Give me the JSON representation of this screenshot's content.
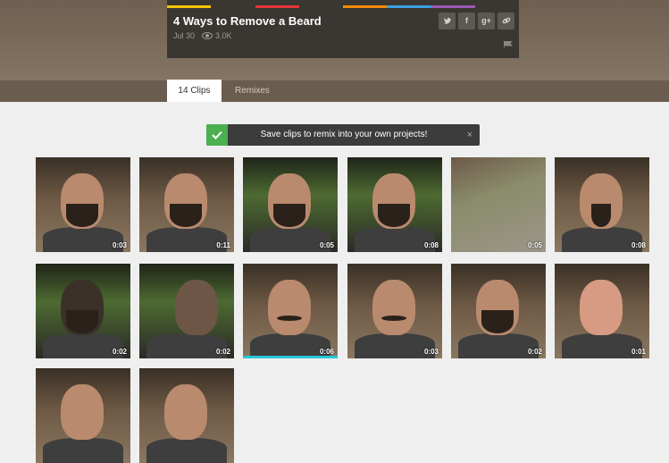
{
  "video": {
    "title": "4 Ways to Remove a Beard",
    "date": "Jul 30",
    "views": "3.0K",
    "share_buttons": [
      "twitter-icon",
      "facebook-icon",
      "google-plus-icon",
      "link-icon"
    ],
    "stripe_colors": [
      "#f5c400",
      "#3a3631",
      "#e3353a",
      "#3a3631",
      "#f28c00",
      "#3aa0e0",
      "#9b59b6",
      "#3a3631"
    ]
  },
  "tabs": [
    {
      "label": "14 Clips",
      "active": true
    },
    {
      "label": "Remixes",
      "active": false
    }
  ],
  "notice": {
    "message": "Save clips to remix into your own projects!",
    "close": "×"
  },
  "clips": [
    {
      "duration": "0:03",
      "scene": "indoor",
      "beard": "full"
    },
    {
      "duration": "0:11",
      "scene": "indoor",
      "beard": "hand"
    },
    {
      "duration": "0:05",
      "scene": "outdoor",
      "beard": "full"
    },
    {
      "duration": "0:08",
      "scene": "outdoor",
      "beard": "full"
    },
    {
      "duration": "0:05",
      "scene": "yard",
      "beard": "none"
    },
    {
      "duration": "0:08",
      "scene": "indoor",
      "beard": "goatee"
    },
    {
      "duration": "0:02",
      "scene": "outdoor",
      "beard": "dark"
    },
    {
      "duration": "0:02",
      "scene": "outdoor",
      "beard": "profile"
    },
    {
      "duration": "0:06",
      "scene": "indoor",
      "beard": "stache",
      "progress": 1.0
    },
    {
      "duration": "0:03",
      "scene": "indoor",
      "beard": "stache"
    },
    {
      "duration": "0:02",
      "scene": "indoor",
      "beard": "full"
    },
    {
      "duration": "0:01",
      "scene": "indoor",
      "beard": "clean"
    },
    {
      "duration": "",
      "scene": "indoor",
      "beard": "none"
    },
    {
      "duration": "",
      "scene": "indoor",
      "beard": "none"
    }
  ]
}
